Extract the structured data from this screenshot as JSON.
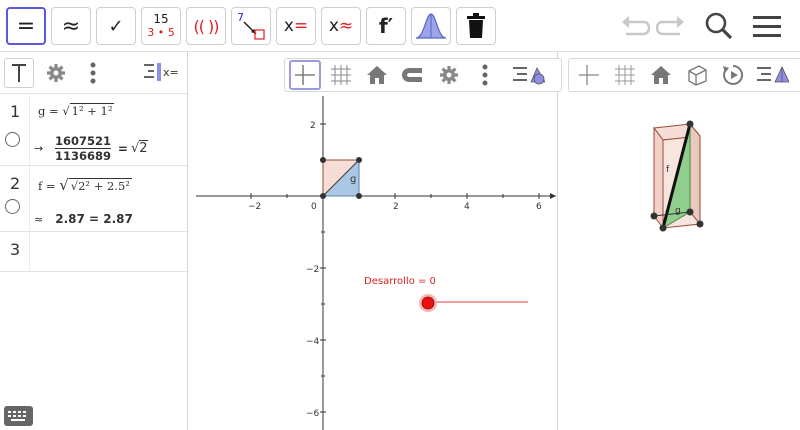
{
  "toolbar": {
    "buttons": [
      {
        "id": "symbolic",
        "label": "="
      },
      {
        "id": "numeric",
        "label": "≈"
      },
      {
        "id": "evaluate",
        "label": "✓"
      },
      {
        "id": "factor_top",
        "label": "15",
        "bottom": "3 • 5"
      },
      {
        "id": "expand",
        "label": "(( ))"
      },
      {
        "id": "substitute",
        "label": "7"
      },
      {
        "id": "solve",
        "label": "x",
        "eq": "="
      },
      {
        "id": "nsolve",
        "label": "x",
        "eq": "≈"
      },
      {
        "id": "derivative",
        "label": "f′"
      },
      {
        "id": "probability",
        "label": ""
      },
      {
        "id": "delete",
        "label": ""
      }
    ]
  },
  "algebra": {
    "rows": [
      {
        "num": "1",
        "def_lhs": "g = ",
        "def_rad": "1² + 1²",
        "out_prefix": "→",
        "frac_num": "1607521",
        "frac_den": "1136689",
        "out_eq": "=",
        "out_rad": "2"
      },
      {
        "num": "2",
        "def_lhs": "f = ",
        "def_inner_rad": "2",
        "def_tail": "² + 2.5²",
        "out_prefix": "≈",
        "out_value": "2.87 = 2.87"
      },
      {
        "num": "3"
      }
    ]
  },
  "graphics": {
    "x_ticks": [
      "−2",
      "0",
      "2",
      "4",
      "6"
    ],
    "y_ticks": [
      "2",
      "−2",
      "−4",
      "−6"
    ],
    "label_g": "g",
    "slider_label": "Desarrollo = 0",
    "slider_value": 0
  },
  "graphics3d": {
    "label_f": "f",
    "label_g": "g"
  },
  "colors": {
    "accent": "#5a5ad8",
    "slider": "#e02020",
    "square_fill": "#f6ddd6",
    "triangle_fill": "#aac8e3",
    "green": "#7fc97f"
  }
}
